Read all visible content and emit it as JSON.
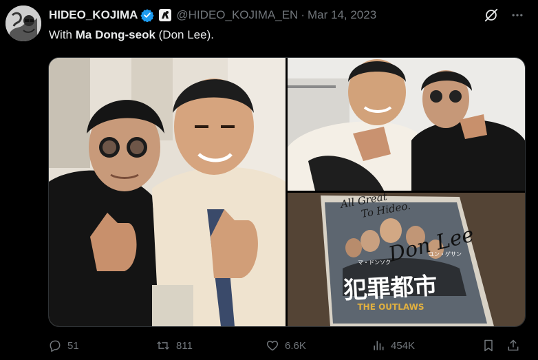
{
  "author": {
    "display_name": "HIDEO_KOJIMA",
    "handle": "@HIDEO_KOJIMA_EN",
    "separator": "·",
    "date": "Mar 14, 2023",
    "verified_color": "#1d9bf0"
  },
  "tweet": {
    "text_prefix": "With ",
    "text_bold": "Ma Dong-seok",
    "text_suffix": " (Don Lee)."
  },
  "media": {
    "photo3_signature": "Don Lee",
    "photo3_dedication_line1": "All Great",
    "photo3_dedication_line2": "To Hideo.",
    "photo3_poster_title": "犯罪都市",
    "photo3_poster_subtitle": "THE OUTLAWS",
    "photo3_poster_name": "マ・ドンソク",
    "photo3_poster_name2": "ユン・ゲサン"
  },
  "actions": {
    "replies": "51",
    "reposts": "811",
    "likes": "6.6K",
    "views": "454K"
  },
  "colors": {
    "background": "#000000",
    "text": "#e7e9ea",
    "muted": "#71767b",
    "accent": "#1d9bf0"
  }
}
